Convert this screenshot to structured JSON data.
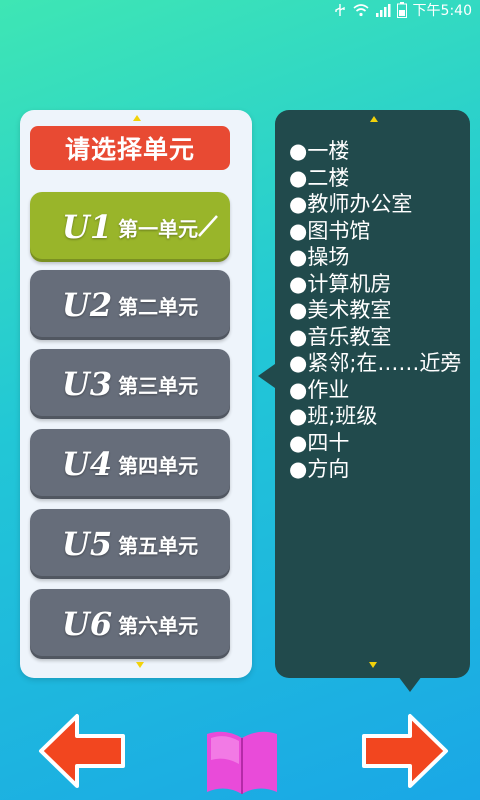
{
  "status_bar": {
    "time": "下午5:40",
    "icons": [
      "usb-icon",
      "wifi-icon",
      "signal-icon",
      "battery-icon"
    ]
  },
  "left_panel": {
    "title": "请选择单元",
    "units": [
      {
        "code": "U1",
        "label": "第一单元",
        "selected": true
      },
      {
        "code": "U2",
        "label": "第二单元",
        "selected": false
      },
      {
        "code": "U3",
        "label": "第三单元",
        "selected": false
      },
      {
        "code": "U4",
        "label": "第四单元",
        "selected": false
      },
      {
        "code": "U5",
        "label": "第五单元",
        "selected": false
      },
      {
        "code": "U6",
        "label": "第六单元",
        "selected": false
      }
    ]
  },
  "right_panel": {
    "words": [
      "●一楼",
      "●二楼",
      "●教师办公室",
      "●图书馆",
      "●操场",
      "●计算机房",
      "●美术教室",
      "●音乐教室",
      "●紧邻;在……近旁",
      "●作业",
      "●班;班级",
      "●四十",
      "●方向"
    ]
  },
  "colors": {
    "title_bg": "#e84a33",
    "selected_unit_bg": "#99b52a",
    "unit_bg": "#666d7a",
    "list_panel_bg": "#214a4c",
    "scroll_indicator": "#f2d20a",
    "arrow": "#f2461f",
    "book": "#e94bd9"
  },
  "controls": {
    "prev_icon": "left-arrow-icon",
    "next_icon": "right-arrow-icon",
    "book_icon": "open-book-icon"
  }
}
